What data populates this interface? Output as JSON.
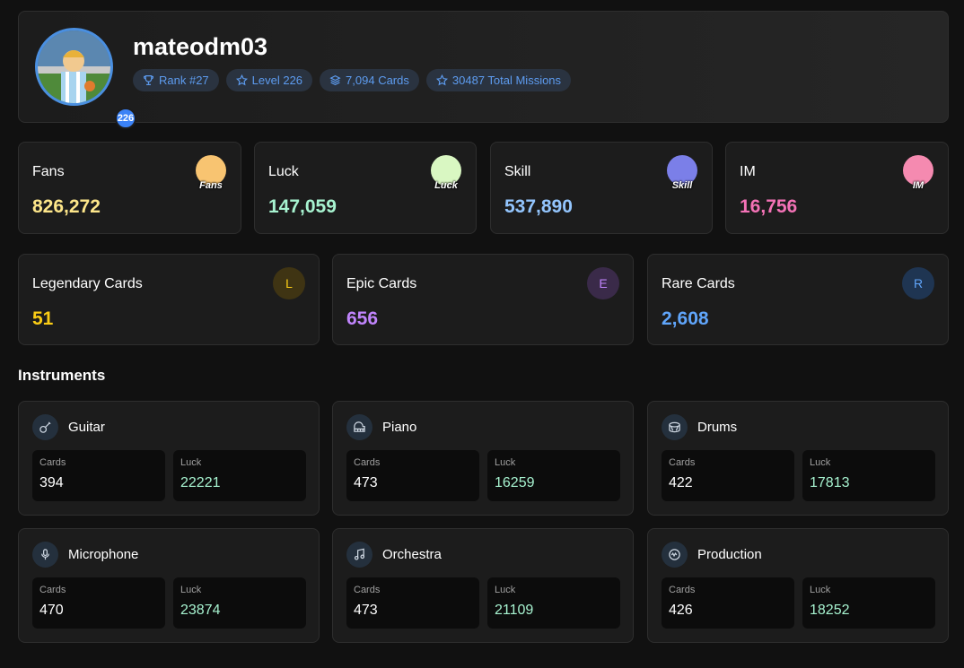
{
  "profile": {
    "username": "mateodm03",
    "level_badge": "226",
    "pills": [
      {
        "icon": "trophy-icon",
        "label": "Rank #27"
      },
      {
        "icon": "star-icon",
        "label": "Level 226"
      },
      {
        "icon": "layers-icon",
        "label": "7,094 Cards"
      },
      {
        "icon": "star-icon",
        "label": "30487 Total Missions"
      }
    ]
  },
  "stats": [
    {
      "label": "Fans",
      "value": "826,272",
      "color": "#fde68a",
      "icon": "fans-icon",
      "icon_text": "Fans",
      "icon_bg": "#f8c471"
    },
    {
      "label": "Luck",
      "value": "147,059",
      "color": "#a7f3d0",
      "icon": "clover-icon",
      "icon_text": "Luck",
      "icon_bg": "#d9f7c2"
    },
    {
      "label": "Skill",
      "value": "537,890",
      "color": "#93c5fd",
      "icon": "skill-icon",
      "icon_text": "Skill",
      "icon_bg": "#7b7fe8"
    },
    {
      "label": "IM",
      "value": "16,756",
      "color": "#f472b6",
      "icon": "im-icon",
      "icon_text": "IM",
      "icon_bg": "#f58ab0"
    }
  ],
  "rarities": [
    {
      "label": "Legendary Cards",
      "value": "51",
      "letter": "L",
      "color": "#facc15",
      "bg": "#3f3413"
    },
    {
      "label": "Epic Cards",
      "value": "656",
      "letter": "E",
      "color": "#c084fc",
      "bg": "#3a2a49"
    },
    {
      "label": "Rare Cards",
      "value": "2,608",
      "letter": "R",
      "color": "#60a5fa",
      "bg": "#1f3552"
    }
  ],
  "instruments_title": "Instruments",
  "instruments": [
    {
      "name": "Guitar",
      "icon": "guitar-icon",
      "cards_label": "Cards",
      "cards": "394",
      "luck_label": "Luck",
      "luck": "22221"
    },
    {
      "name": "Piano",
      "icon": "piano-icon",
      "cards_label": "Cards",
      "cards": "473",
      "luck_label": "Luck",
      "luck": "16259"
    },
    {
      "name": "Drums",
      "icon": "drum-icon",
      "cards_label": "Cards",
      "cards": "422",
      "luck_label": "Luck",
      "luck": "17813"
    },
    {
      "name": "Microphone",
      "icon": "microphone-icon",
      "cards_label": "Cards",
      "cards": "470",
      "luck_label": "Luck",
      "luck": "23874"
    },
    {
      "name": "Orchestra",
      "icon": "music-note-icon",
      "cards_label": "Cards",
      "cards": "473",
      "luck_label": "Luck",
      "luck": "21109"
    },
    {
      "name": "Production",
      "icon": "production-icon",
      "cards_label": "Cards",
      "cards": "426",
      "luck_label": "Luck",
      "luck": "18252"
    }
  ],
  "colors": {
    "accent": "#3b82f6",
    "luck_value": "#a7f3d0",
    "background": "#111111",
    "card": "#1c1c1c"
  }
}
